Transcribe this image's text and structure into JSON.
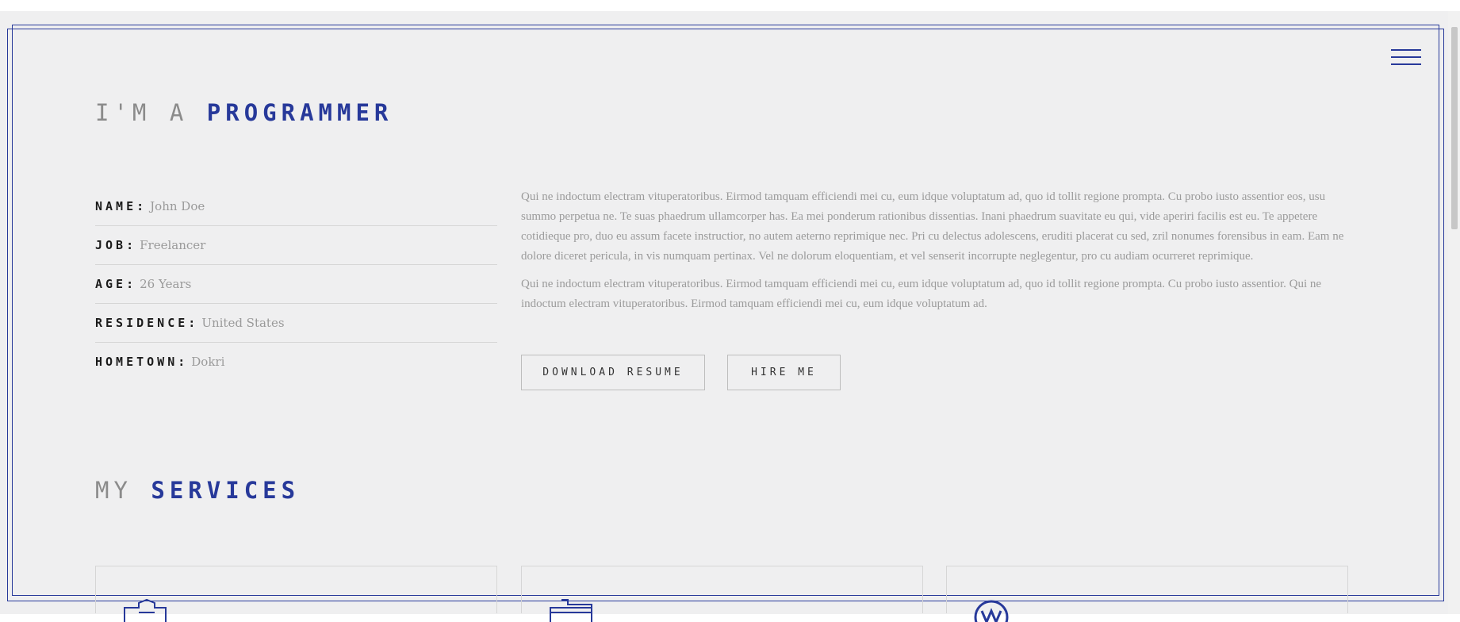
{
  "header": {
    "menu_icon": "hamburger-menu-icon"
  },
  "about": {
    "heading_light": "I'M A",
    "heading_accent": "PROGRAMMER",
    "info": [
      {
        "label": "NAME:",
        "value": "John Doe"
      },
      {
        "label": "JOB:",
        "value": "Freelancer"
      },
      {
        "label": "AGE:",
        "value": "26 Years"
      },
      {
        "label": "RESIDENCE:",
        "value": "United States"
      },
      {
        "label": "HOMETOWN:",
        "value": "Dokri"
      }
    ],
    "bio": [
      "Qui ne indoctum electram vituperatoribus. Eirmod tamquam efficiendi mei cu, eum idque voluptatum ad, quo id tollit regione prompta. Cu probo iusto assentior eos, usu summo perpetua ne. Te suas phaedrum ullamcorper has. Ea mei ponderum rationibus dissentias. Inani phaedrum suavitate eu qui, vide aperiri facilis est eu. Te appetere cotidieque pro, duo eu assum facete instructior, no autem aeterno reprimique nec. Pri cu delectus adolescens, eruditi placerat cu sed, zril nonumes forensibus in eam. Eam ne dolore diceret pericula, in vis numquam pertinax. Vel ne dolorum eloquentiam, et vel senserit incorrupte neglegentur, pro cu audiam ocurreret reprimique.",
      "Qui ne indoctum electram vituperatoribus. Eirmod tamquam efficiendi mei cu, eum idque voluptatum ad, quo id tollit regione prompta. Cu probo iusto assentior. Qui ne indoctum electram vituperatoribus. Eirmod tamquam efficiendi mei cu, eum idque voluptatum ad."
    ],
    "buttons": {
      "resume": "DOWNLOAD RESUME",
      "hire": "HIRE ME"
    }
  },
  "services": {
    "heading_light": "MY",
    "heading_accent": "SERVICES",
    "cards": [
      {
        "icon": "puzzle-icon"
      },
      {
        "icon": "keyboard-icon"
      },
      {
        "icon": "wordpress-icon"
      }
    ]
  },
  "colors": {
    "accent": "#27399a",
    "background": "#efeff0"
  }
}
